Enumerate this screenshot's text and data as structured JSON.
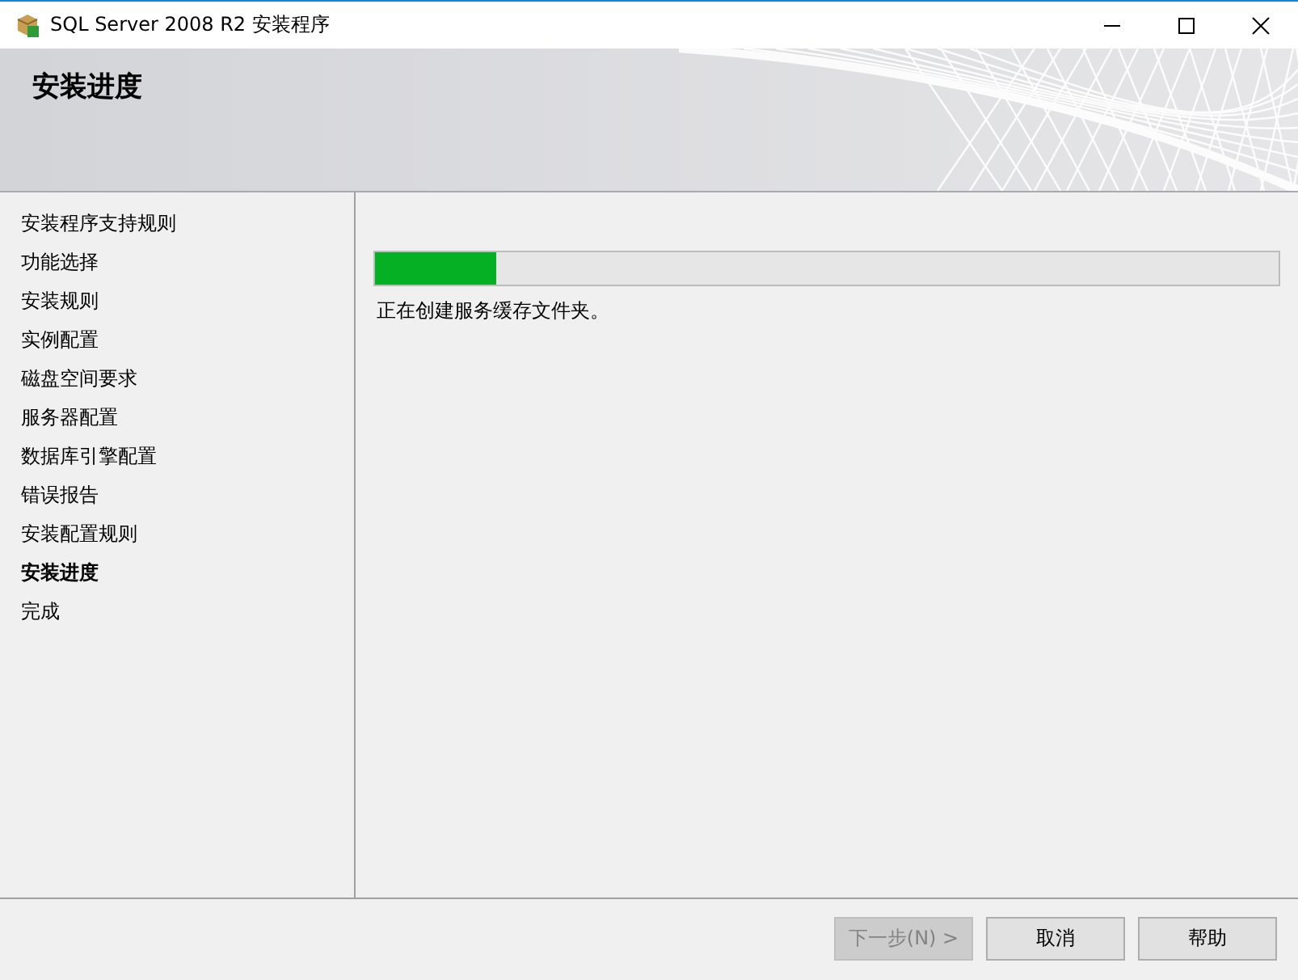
{
  "window": {
    "title": "SQL Server 2008 R2 安装程序"
  },
  "header": {
    "title": "安装进度"
  },
  "sidebar": {
    "items": [
      {
        "label": "安装程序支持规则",
        "selected": false
      },
      {
        "label": "功能选择",
        "selected": false
      },
      {
        "label": "安装规则",
        "selected": false
      },
      {
        "label": "实例配置",
        "selected": false
      },
      {
        "label": "磁盘空间要求",
        "selected": false
      },
      {
        "label": "服务器配置",
        "selected": false
      },
      {
        "label": "数据库引擎配置",
        "selected": false
      },
      {
        "label": "错误报告",
        "selected": false
      },
      {
        "label": "安装配置规则",
        "selected": false
      },
      {
        "label": "安装进度",
        "selected": true
      },
      {
        "label": "完成",
        "selected": false
      }
    ]
  },
  "progress": {
    "level": 0.135,
    "status": "正在创建服务缓存文件夹。"
  },
  "buttons": [
    {
      "label": "下一步(N) >",
      "disabled": true
    },
    {
      "label": "取消",
      "disabled": false
    },
    {
      "label": "帮助",
      "disabled": false
    }
  ]
}
